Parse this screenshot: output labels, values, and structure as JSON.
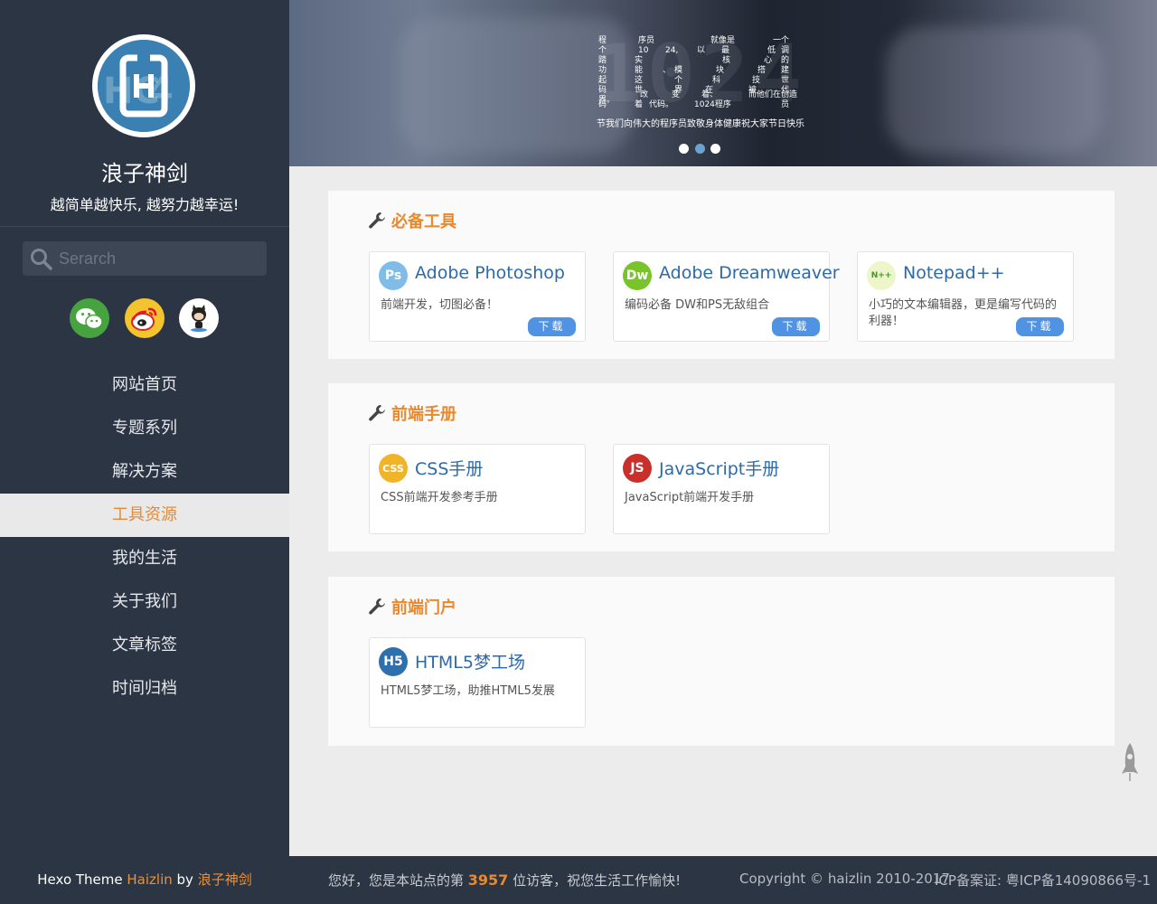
{
  "sidebar": {
    "site_title": "浪子神剑",
    "site_subtitle": "越简单越快乐, 越努力越幸运!",
    "search_placeholder": "Serarch",
    "social": [
      {
        "icon": "wechat-icon",
        "color": "#4aa941"
      },
      {
        "icon": "weibo-icon",
        "color": "#e6162d"
      },
      {
        "icon": "github-icon",
        "color": "#ffffff"
      }
    ],
    "nav": [
      {
        "label": "网站首页",
        "active": false
      },
      {
        "label": "专题系列",
        "active": false
      },
      {
        "label": "解决方案",
        "active": false
      },
      {
        "label": "工具资源",
        "active": true
      },
      {
        "label": "我的生活",
        "active": false
      },
      {
        "label": "关于我们",
        "active": false
      },
      {
        "label": "文章标签",
        "active": false
      },
      {
        "label": "时间归档",
        "active": false
      }
    ],
    "footer": {
      "prefix": "Hexo Theme ",
      "theme": "Haizlin",
      "by": " by ",
      "author": "浪子神剑"
    }
  },
  "banner": {
    "caption": "节我们向伟大的程序员致敬身体健康祝大家节日快乐",
    "poem": {
      "c1": "程个踏功起码",
      "c2": "序员",
      "c3": "10",
      "c4": "24,",
      "c5": "就像是",
      "c6": "以",
      "c7": "最",
      "c8": "一个",
      "c9": "低",
      "c10": "调",
      "r2a": "实",
      "r2b": "核",
      "r2c": "心",
      "r2d": "的",
      "r2e": "建",
      "r3a": "能",
      "r3b": "、",
      "r3c": "模",
      "r3d": "块",
      "r3e": "搭",
      "r3f": "世",
      "r4a": "这",
      "r4b": "个",
      "r4c": "科",
      "r4d": "技",
      "r4e": "代",
      "r5a": "世",
      "r5b": "界",
      "r5c": "在",
      "r5d": "被",
      "r6a": "改",
      "r6b": "变",
      "r6c": "着、",
      "r6d": "而他们在创造",
      "r7a": "界。",
      "r7b": "码",
      "r7c": "着",
      "r7d": "代码。",
      "r7e": "1024程序",
      "r7f": "员"
    },
    "dots": 3,
    "active_dot": 1
  },
  "sections": [
    {
      "title": "必备工具",
      "items": [
        {
          "name": "Adobe Photoshop",
          "icon_text": "Ps",
          "icon": "photoshop-icon",
          "icon_color": "#7fbde8",
          "desc": "前端开发，切图必备！",
          "download": "下载"
        },
        {
          "name": "Adobe Dreamweaver",
          "icon_text": "Dw",
          "icon": "dreamweaver-icon",
          "icon_color": "#78c42a",
          "desc": "编码必备 DW和PS无敌组合",
          "download": "下载"
        },
        {
          "name": "Notepad++",
          "icon_text": "N++",
          "icon": "notepad-plus-plus-icon",
          "icon_color": "#eef5c9",
          "desc": "小巧的文本编辑器，更是编写代码的利器！",
          "download": "下载"
        }
      ]
    },
    {
      "title": "前端手册",
      "items": [
        {
          "name": "CSS手册",
          "icon_text": "CSS",
          "icon": "css-icon",
          "icon_color": "#f0b428",
          "desc": "CSS前端开发参考手册"
        },
        {
          "name": "JavaScript手册",
          "icon_text": "JS",
          "icon": "javascript-icon",
          "icon_color": "#c9302c",
          "desc": "JavaScript前端开发手册"
        }
      ]
    },
    {
      "title": "前端门户",
      "items": [
        {
          "name": "HTML5梦工场",
          "icon_text": "H5",
          "icon": "html5-icon",
          "icon_color": "#2e6fad",
          "desc": "HTML5梦工场，助推HTML5发展"
        }
      ]
    }
  ],
  "footer": {
    "visit_prefix": "您好，您是本站点的第 ",
    "visit_count": "3957",
    "visit_suffix": " 位访客，祝您生活工作愉快!",
    "copyright": "Copyright © haizlin 2010-2017",
    "icp": "ICP备案证: 粤ICP备14090866号-1"
  }
}
